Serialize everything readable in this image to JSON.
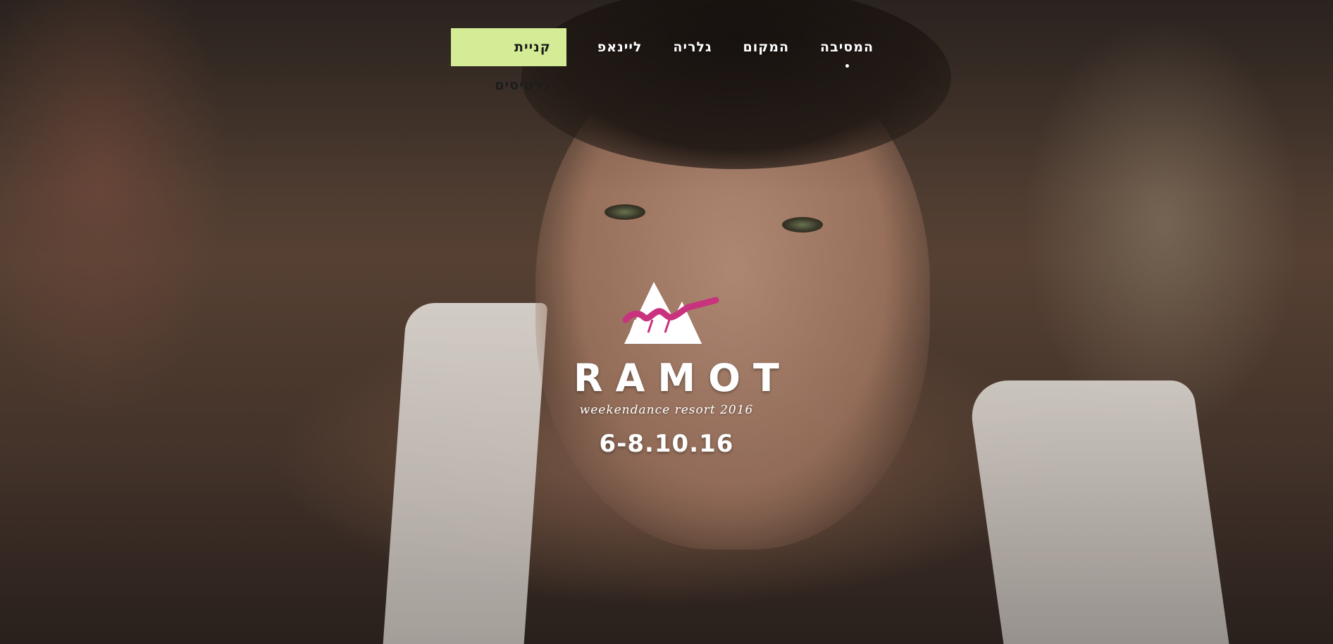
{
  "nav": {
    "items": [
      {
        "label": "המסיבה",
        "active": true
      },
      {
        "label": "המקום",
        "active": false
      },
      {
        "label": "גלריה",
        "active": false
      },
      {
        "label": "ליינאפ",
        "active": false
      }
    ],
    "cta_label": "קניית כרטיסים",
    "cta_color": "#d3ec95"
  },
  "brand": {
    "logo_icon": "mountains-logo-icon",
    "name": "RAMOT",
    "tagline": "weekendance resort 2016",
    "dates": "6-8.10.16",
    "accent_color": "#c9327d"
  },
  "hero": {
    "background": "photo-of-man-in-white-tank-top"
  }
}
